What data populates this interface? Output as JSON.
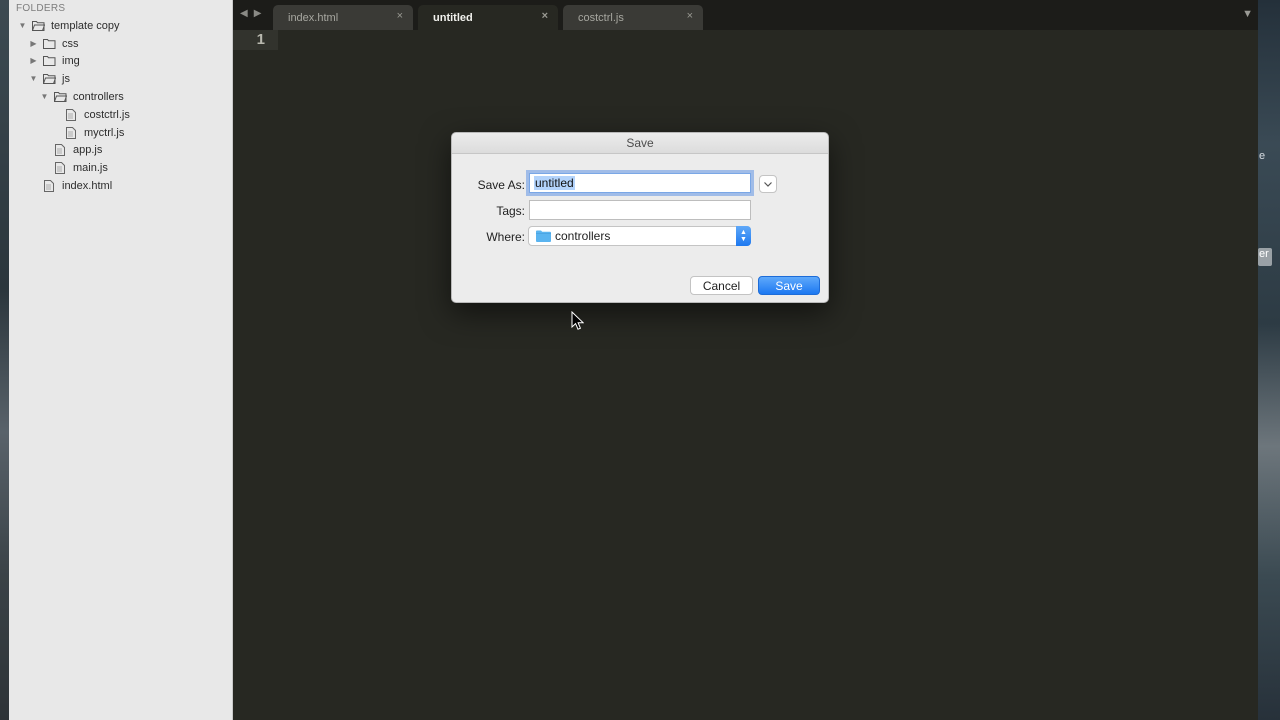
{
  "sidebar": {
    "heading": "FOLDERS",
    "tree": [
      {
        "label": "template copy",
        "type": "folder",
        "expanded": true,
        "depth": 0
      },
      {
        "label": "css",
        "type": "folder",
        "expanded": false,
        "depth": 1
      },
      {
        "label": "img",
        "type": "folder",
        "expanded": false,
        "depth": 1
      },
      {
        "label": "js",
        "type": "folder",
        "expanded": true,
        "depth": 1
      },
      {
        "label": "controllers",
        "type": "folder",
        "expanded": true,
        "depth": 2
      },
      {
        "label": "costctrl.js",
        "type": "file",
        "depth": 3
      },
      {
        "label": "myctrl.js",
        "type": "file",
        "depth": 3
      },
      {
        "label": "app.js",
        "type": "file",
        "depth": 2
      },
      {
        "label": "main.js",
        "type": "file",
        "depth": 2
      },
      {
        "label": "index.html",
        "type": "file",
        "depth": 1
      }
    ]
  },
  "tabs": [
    {
      "label": "index.html",
      "active": false
    },
    {
      "label": "untitled",
      "active": true
    },
    {
      "label": "costctrl.js",
      "active": false
    }
  ],
  "tab_close_glyph": "×",
  "editor": {
    "line_number": "1"
  },
  "dialog": {
    "title": "Save",
    "save_as_label": "Save As:",
    "save_as_value": "untitled",
    "tags_label": "Tags:",
    "tags_value": "",
    "where_label": "Where:",
    "where_value": "controllers",
    "cancel_label": "Cancel",
    "save_label": "Save"
  },
  "wallpaper_fragments": [
    "e",
    "er"
  ],
  "colors": {
    "accent": "#1d78f0",
    "editor_bg": "#272822",
    "sidebar_bg": "#e8e8e8",
    "selection": "#b3d3fb",
    "folder_icon": "#5ab4f0"
  }
}
